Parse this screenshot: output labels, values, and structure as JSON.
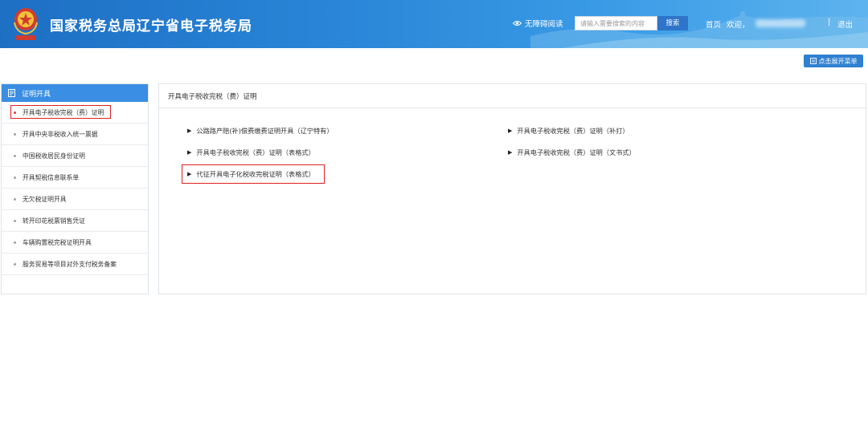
{
  "header": {
    "title": "国家税务总局辽宁省电子税务局",
    "accessibility_label": "无障碍阅读",
    "search_placeholder": "请输入需要搜索的内容",
    "search_button": "搜索",
    "home_link": "首页",
    "welcome_text": "欢迎，",
    "separator": "|",
    "logout_link": "退出",
    "colors": {
      "banner_start": "#1d6fc4",
      "banner_end": "#5db3ee"
    }
  },
  "toolbar": {
    "expand_menu_label": "点击展开菜单",
    "expand_menu_icon": "menu-icon"
  },
  "sidebar": {
    "header_label": "证明开具",
    "header_icon": "document-icon",
    "items": [
      {
        "label": "开具电子税收完税（费）证明",
        "active": true
      },
      {
        "label": "开具中央非税收入统一票据"
      },
      {
        "label": "中国税收居民身份证明"
      },
      {
        "label": "开具契税信息联系单"
      },
      {
        "label": "无欠税证明开具"
      },
      {
        "label": "转开印花税票销售凭证"
      },
      {
        "label": "车辆购置税完税证明开具"
      },
      {
        "label": "服务贸易等项目对外支付税务备案"
      }
    ]
  },
  "main": {
    "title": "开具电子税收完税（费）证明",
    "links": [
      {
        "label": "公路路产赔(补)偿费缴费证明开具（辽宁特有）"
      },
      {
        "label": "开具电子税收完税（费）证明（补打）"
      },
      {
        "label": "开具电子税收完税（费）证明（表格式）"
      },
      {
        "label": "开具电子税收完税（费）证明（文书式）"
      },
      {
        "label": "代征开具电子化税收完税证明（表格式）"
      }
    ],
    "highlight_color": "#e02020"
  }
}
